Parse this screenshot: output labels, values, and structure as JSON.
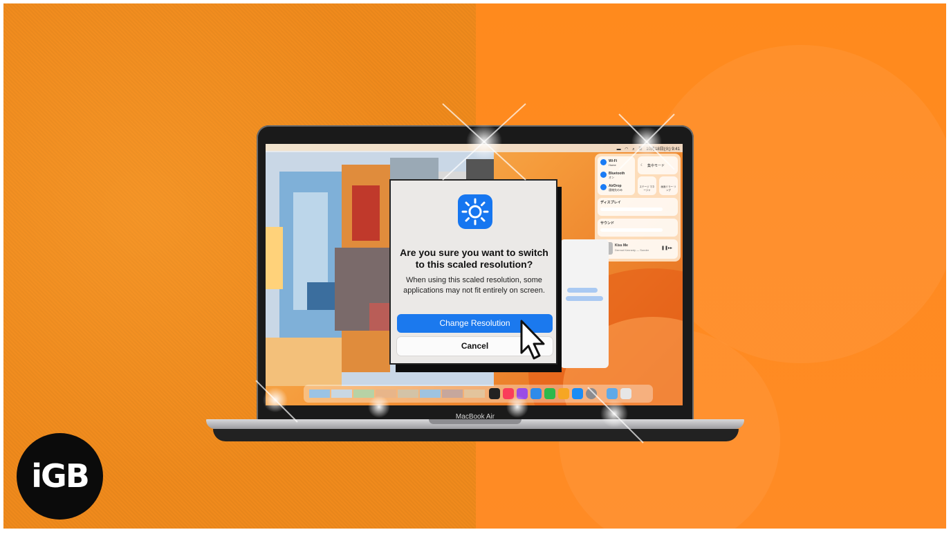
{
  "colors": {
    "background_left": "#f08a1c",
    "background_right": "#ff8a1d",
    "accent_blue": "#1b79ee",
    "dialog_bg": "#ebe9e7"
  },
  "menubar": {
    "clock": "10月18日(火) 9:41"
  },
  "control_center": {
    "wifi_label": "Wi-Fi",
    "wifi_sub": "Home",
    "bluetooth_label": "Bluetooth",
    "bluetooth_sub": "オン",
    "airdrop_label": "AirDrop",
    "airdrop_sub": "連絡先のみ",
    "focus_label": "集中モード",
    "stage_label": "ステージ マネージャ",
    "mirror_label": "画面ミラー リング",
    "display_label": "ディスプレイ",
    "sound_label": "サウンド",
    "now_playing_title": "Kiss Me",
    "now_playing_artist": "Dermot Kennedy — Sonder"
  },
  "dialog": {
    "icon": "brightness-sun-icon",
    "title": "Are you sure you want to switch to this scaled resolution?",
    "message": "When using this scaled resolution, some applications may not fit entirely on screen.",
    "primary_button": "Change Resolution",
    "secondary_button": "Cancel"
  },
  "dock": {
    "apps": [
      "apple-tv-icon",
      "music-icon",
      "podcasts-icon",
      "keynote-icon",
      "numbers-icon",
      "pages-icon",
      "app-store-icon",
      "system-settings-icon",
      "finder-folder-icon",
      "trash-icon"
    ]
  },
  "laptop": {
    "model_label": "MacBook Air"
  },
  "brand": {
    "logo_text": "iGB"
  }
}
